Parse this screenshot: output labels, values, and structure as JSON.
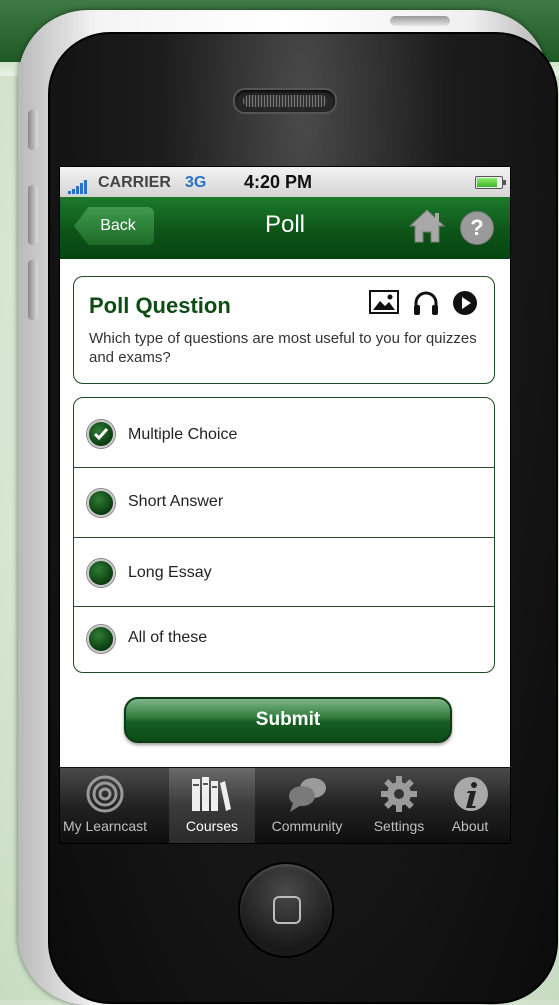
{
  "status": {
    "carrier": "CARRIER",
    "network": "3G",
    "time": "4:20 PM"
  },
  "nav": {
    "back_label": "Back",
    "title": "Poll"
  },
  "question": {
    "title": "Poll Question",
    "text": "Which type of questions are most useful to you for quizzes and exams?"
  },
  "options": [
    {
      "label": "Multiple Choice",
      "selected": true
    },
    {
      "label": "Short Answer",
      "selected": false
    },
    {
      "label": "Long Essay",
      "selected": false
    },
    {
      "label": "All of these",
      "selected": false
    }
  ],
  "submit_label": "Submit",
  "tabs": [
    {
      "label": "My Learncast",
      "icon": "target-icon",
      "active": false
    },
    {
      "label": "Courses",
      "icon": "books-icon",
      "active": true
    },
    {
      "label": "Community",
      "icon": "chat-bubbles-icon",
      "active": false
    },
    {
      "label": "Settings",
      "icon": "gear-icon",
      "active": false
    },
    {
      "label": "About",
      "icon": "info-icon",
      "active": false
    }
  ],
  "colors": {
    "brand_green": "#0e5518",
    "accent_blue": "#2a72c8"
  }
}
